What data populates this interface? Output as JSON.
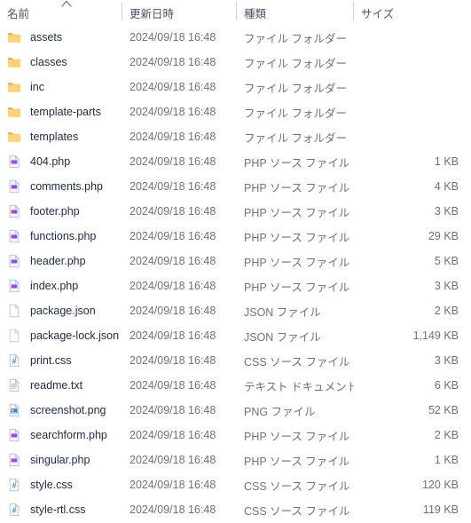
{
  "window": {
    "view": "details-list"
  },
  "columns": {
    "sort": {
      "column": "name",
      "direction": "ascending",
      "indicator": "chevron-up-icon"
    },
    "headers": [
      {
        "key": "name",
        "label": "名前"
      },
      {
        "key": "date",
        "label": "更新日時"
      },
      {
        "key": "type",
        "label": "種類"
      },
      {
        "key": "size",
        "label": "サイズ"
      }
    ]
  },
  "colors": {
    "folder": "#ffc44d",
    "folder_dark": "#e8a317",
    "php_accent": "#8a2be2",
    "css_accent": "#2f7fd1",
    "png_accent": "#2f7fd1",
    "text_primary": "#1d2b44",
    "text_secondary": "#6b7280",
    "header_text": "#4a5568",
    "divider": "#cfd4da",
    "background": "#ffffff"
  },
  "rows": [
    {
      "name": "assets",
      "icon": "folder-icon",
      "date": "2024/09/18 16:48",
      "type": "ファイル フォルダー",
      "size": ""
    },
    {
      "name": "classes",
      "icon": "folder-icon",
      "date": "2024/09/18 16:48",
      "type": "ファイル フォルダー",
      "size": ""
    },
    {
      "name": "inc",
      "icon": "folder-icon",
      "date": "2024/09/18 16:48",
      "type": "ファイル フォルダー",
      "size": ""
    },
    {
      "name": "template-parts",
      "icon": "folder-icon",
      "date": "2024/09/18 16:48",
      "type": "ファイル フォルダー",
      "size": ""
    },
    {
      "name": "templates",
      "icon": "folder-icon",
      "date": "2024/09/18 16:48",
      "type": "ファイル フォルダー",
      "size": ""
    },
    {
      "name": "404.php",
      "icon": "php-file-icon",
      "date": "2024/09/18 16:48",
      "type": "PHP ソース ファイル",
      "size": "1 KB"
    },
    {
      "name": "comments.php",
      "icon": "php-file-icon",
      "date": "2024/09/18 16:48",
      "type": "PHP ソース ファイル",
      "size": "4 KB"
    },
    {
      "name": "footer.php",
      "icon": "php-file-icon",
      "date": "2024/09/18 16:48",
      "type": "PHP ソース ファイル",
      "size": "3 KB"
    },
    {
      "name": "functions.php",
      "icon": "php-file-icon",
      "date": "2024/09/18 16:48",
      "type": "PHP ソース ファイル",
      "size": "29 KB"
    },
    {
      "name": "header.php",
      "icon": "php-file-icon",
      "date": "2024/09/18 16:48",
      "type": "PHP ソース ファイル",
      "size": "5 KB"
    },
    {
      "name": "index.php",
      "icon": "php-file-icon",
      "date": "2024/09/18 16:48",
      "type": "PHP ソース ファイル",
      "size": "3 KB"
    },
    {
      "name": "package.json",
      "icon": "json-file-icon",
      "date": "2024/09/18 16:48",
      "type": "JSON ファイル",
      "size": "2 KB"
    },
    {
      "name": "package-lock.json",
      "icon": "json-file-icon",
      "date": "2024/09/18 16:48",
      "type": "JSON ファイル",
      "size": "1,149 KB"
    },
    {
      "name": "print.css",
      "icon": "css-file-icon",
      "date": "2024/09/18 16:48",
      "type": "CSS ソース ファイル",
      "size": "3 KB"
    },
    {
      "name": "readme.txt",
      "icon": "text-file-icon",
      "date": "2024/09/18 16:48",
      "type": "テキスト ドキュメント",
      "size": "6 KB"
    },
    {
      "name": "screenshot.png",
      "icon": "image-file-icon",
      "date": "2024/09/18 16:48",
      "type": "PNG ファイル",
      "size": "52 KB"
    },
    {
      "name": "searchform.php",
      "icon": "php-file-icon",
      "date": "2024/09/18 16:48",
      "type": "PHP ソース ファイル",
      "size": "2 KB"
    },
    {
      "name": "singular.php",
      "icon": "php-file-icon",
      "date": "2024/09/18 16:48",
      "type": "PHP ソース ファイル",
      "size": "1 KB"
    },
    {
      "name": "style.css",
      "icon": "css-file-icon",
      "date": "2024/09/18 16:48",
      "type": "CSS ソース ファイル",
      "size": "120 KB"
    },
    {
      "name": "style-rtl.css",
      "icon": "css-file-icon",
      "date": "2024/09/18 16:48",
      "type": "CSS ソース ファイル",
      "size": "119 KB"
    }
  ]
}
